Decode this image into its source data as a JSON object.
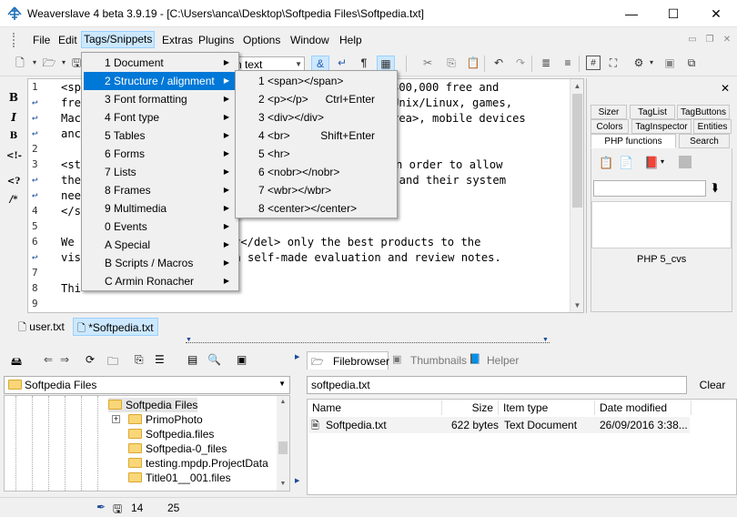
{
  "window": {
    "title": "Weaverslave 4 beta 3.9.19 - [C:\\Users\\anca\\Desktop\\Softpedia Files\\Softpedia.txt]",
    "minimize": "—",
    "maximize": "☐",
    "close": "✕"
  },
  "menubar": [
    "File",
    "Edit",
    "Tags/Snippets",
    "Extras",
    "Plugins",
    "Options",
    "Window",
    "Help"
  ],
  "toolbar": {
    "combo_text": "n text"
  },
  "left_tools": [
    "B",
    "I",
    "B",
    "<!-",
    "<?",
    "/*"
  ],
  "editor": {
    "line_numbers": [
      "1",
      "",
      "",
      "",
      "2",
      "3",
      "",
      "",
      "4",
      "5",
      "6",
      "",
      "7",
      "8",
      "9"
    ],
    "lines": [
      "<sp",
      "fre",
      "Mac",
      "anc",
      "",
      "<st",
      "the",
      "nee",
      "</s",
      "",
      "We ",
      "vis",
      "",
      "Thi",
      ""
    ],
    "right_fragments": [
      {
        "row": 0,
        "text": "300,000 free and"
      },
      {
        "row": 1,
        "text": "Unix/Linux, games,"
      },
      {
        "row": 2,
        "text": "rea>, mobile devices"
      },
      {
        "row": 5,
        "text": "s in order to allow"
      },
      {
        "row": 6,
        "text": "y and their system"
      },
      {
        "row": 10,
        "text": "r</del> only the best products to the"
      },
      {
        "row": 11,
        "text": "ch self-made evaluation and review notes."
      }
    ]
  },
  "tags_menu": {
    "items": [
      "1 Document",
      "2 Structure / alignment",
      "3 Font formatting",
      "4 Font type",
      "5 Tables",
      "6 Forms",
      "7 Lists",
      "8 Frames",
      "9 Multimedia",
      "0 Events",
      "A Special",
      "B Scripts / Macros",
      "C Armin Ronacher"
    ],
    "highlighted_index": 1
  },
  "structure_submenu": {
    "items": [
      {
        "label": "1 <span></span>",
        "shortcut": ""
      },
      {
        "label": "2 <p></p>",
        "shortcut": "Ctrl+Enter"
      },
      {
        "label": "3 <div></div>",
        "shortcut": ""
      },
      {
        "label": "4 <br>",
        "shortcut": "Shift+Enter"
      },
      {
        "label": "5 <hr>",
        "shortcut": ""
      },
      {
        "label": "6 <nobr></nobr>",
        "shortcut": ""
      },
      {
        "label": "7 <wbr></wbr>",
        "shortcut": ""
      },
      {
        "label": "8 <center></center>",
        "shortcut": ""
      }
    ]
  },
  "right_panel": {
    "close": "✕",
    "tabs_row1": [
      "Sizer",
      "TagList",
      "TagButtons"
    ],
    "tabs_row2": [
      "Colors",
      "TagInspector",
      "Entities"
    ],
    "tabs_row3": [
      "PHP functions",
      "Search"
    ],
    "list_item": "PHP 5_cvs"
  },
  "doc_tabs": [
    "user.txt",
    "*Softpedia.txt"
  ],
  "file_panel": {
    "path_combo": "Softpedia Files",
    "tree": [
      {
        "label": "Softpedia Files",
        "level": 0,
        "selected": true
      },
      {
        "label": "PrimoPhoto",
        "level": 1,
        "expander": "+"
      },
      {
        "label": "Softpedia.files",
        "level": 1
      },
      {
        "label": "Softpedia-0_files",
        "level": 1
      },
      {
        "label": "testing.mpdp.ProjectData",
        "level": 1
      },
      {
        "label": "Title01__001.files",
        "level": 1
      }
    ]
  },
  "browser_panel": {
    "tabs": [
      "Filebrowser",
      "Thumbnails",
      "Helper"
    ],
    "filter": "softpedia.txt",
    "clear": "Clear",
    "columns": [
      "Name",
      "Size",
      "Item type",
      "Date modified"
    ],
    "rows": [
      {
        "name": "Softpedia.txt",
        "size": "622 bytes",
        "type": "Text Document",
        "modified": "26/09/2016 3:38..."
      }
    ]
  },
  "status": {
    "line": "14",
    "col": "25"
  }
}
